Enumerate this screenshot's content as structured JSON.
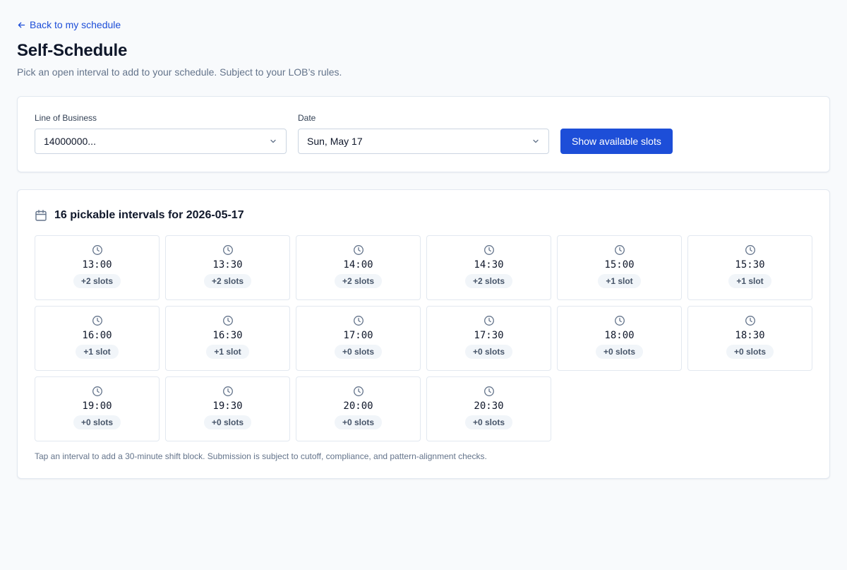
{
  "nav": {
    "back_label": "Back to my schedule"
  },
  "header": {
    "title": "Self-Schedule",
    "subtitle": "Pick an open interval to add to your schedule. Subject to your LOB’s rules."
  },
  "filters": {
    "lob_label": "Line of Business",
    "lob_value": "14000000...",
    "date_label": "Date",
    "date_value": "Sun, May 17",
    "submit_label": "Show available slots"
  },
  "results": {
    "title": "16 pickable intervals for 2026-05-17",
    "footnote": "Tap an interval to add a 30-minute shift block. Submission is subject to cutoff, compliance, and pattern-alignment checks.",
    "intervals": [
      {
        "time": "13:00",
        "slots": "+2 slots"
      },
      {
        "time": "13:30",
        "slots": "+2 slots"
      },
      {
        "time": "14:00",
        "slots": "+2 slots"
      },
      {
        "time": "14:30",
        "slots": "+2 slots"
      },
      {
        "time": "15:00",
        "slots": "+1 slot"
      },
      {
        "time": "15:30",
        "slots": "+1 slot"
      },
      {
        "time": "16:00",
        "slots": "+1 slot"
      },
      {
        "time": "16:30",
        "slots": "+1 slot"
      },
      {
        "time": "17:00",
        "slots": "+0 slots"
      },
      {
        "time": "17:30",
        "slots": "+0 slots"
      },
      {
        "time": "18:00",
        "slots": "+0 slots"
      },
      {
        "time": "18:30",
        "slots": "+0 slots"
      },
      {
        "time": "19:00",
        "slots": "+0 slots"
      },
      {
        "time": "19:30",
        "slots": "+0 slots"
      },
      {
        "time": "20:00",
        "slots": "+0 slots"
      },
      {
        "time": "20:30",
        "slots": "+0 slots"
      }
    ]
  },
  "colors": {
    "accent": "#1d4ed8",
    "text": "#0f172a",
    "muted": "#64748b",
    "border": "#e2e8f0",
    "badge_bg": "#f1f5f9"
  },
  "icons": {
    "back": "arrow-left-icon",
    "dropdown": "chevron-down-icon",
    "calendar": "calendar-icon",
    "slot": "clock-icon"
  }
}
